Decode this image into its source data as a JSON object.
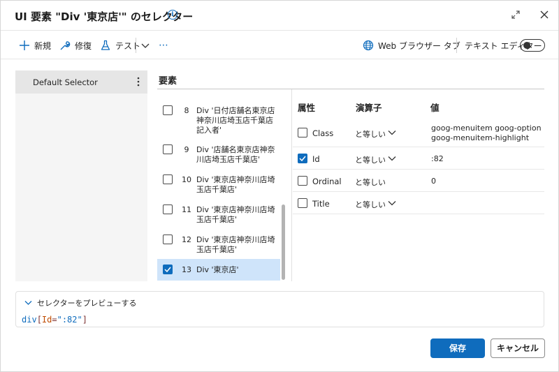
{
  "dialog": {
    "title": "UI 要素 \"Div '東京店'\" のセレクター",
    "info_icon": "i"
  },
  "toolbar": {
    "new_label": "新規",
    "repair_label": "修復",
    "test_label": "テスト",
    "more_label": "⋯",
    "browser_tab_label": "Web ブラウザー タブ",
    "text_editor_label": "テキスト エディター",
    "text_editor_on": false
  },
  "selectors": {
    "items": [
      {
        "label": "Default Selector"
      }
    ]
  },
  "elements": {
    "header": "要素",
    "items": [
      {
        "num": "8",
        "text": "Div '日付店舗名東京店神奈川店埼玉店千葉店記入者'",
        "checked": false
      },
      {
        "num": "9",
        "text": "Div '店舗名東京店神奈川店埼玉店千葉店'",
        "checked": false
      },
      {
        "num": "10",
        "text": "Div '東京店神奈川店埼玉店千葉店'",
        "checked": false
      },
      {
        "num": "11",
        "text": "Div '東京店神奈川店埼玉店千葉店'",
        "checked": false
      },
      {
        "num": "12",
        "text": "Div '東京店神奈川店埼玉店千葉店'",
        "checked": false
      },
      {
        "num": "13",
        "text": "Div '東京店'",
        "checked": true
      }
    ]
  },
  "attributes": {
    "headers": {
      "attribute": "属性",
      "operator": "演算子",
      "value": "値"
    },
    "rows": [
      {
        "name": "Class",
        "operator": "と等しい",
        "value": "goog-menuitem goog-option goog-menuitem-highlight",
        "checked": false,
        "has_dropdown": true
      },
      {
        "name": "Id",
        "operator": "と等しい",
        "value": ":82",
        "checked": true,
        "has_dropdown": true
      },
      {
        "name": "Ordinal",
        "operator": "と等しい",
        "value": "0",
        "checked": false,
        "has_dropdown": false
      },
      {
        "name": "Title",
        "operator": "と等しい",
        "value": "",
        "checked": false,
        "has_dropdown": true
      }
    ]
  },
  "preview": {
    "header": "セレクターをプレビューする",
    "code_tag": "div",
    "code_open": "[",
    "code_attr": "Id",
    "code_eq": "=",
    "code_value": "\":82\"",
    "code_close": "]"
  },
  "footer": {
    "save_label": "保存",
    "cancel_label": "キャンセル"
  },
  "colors": {
    "accent": "#0f6cbd",
    "selected_row": "#cfe4fa"
  }
}
